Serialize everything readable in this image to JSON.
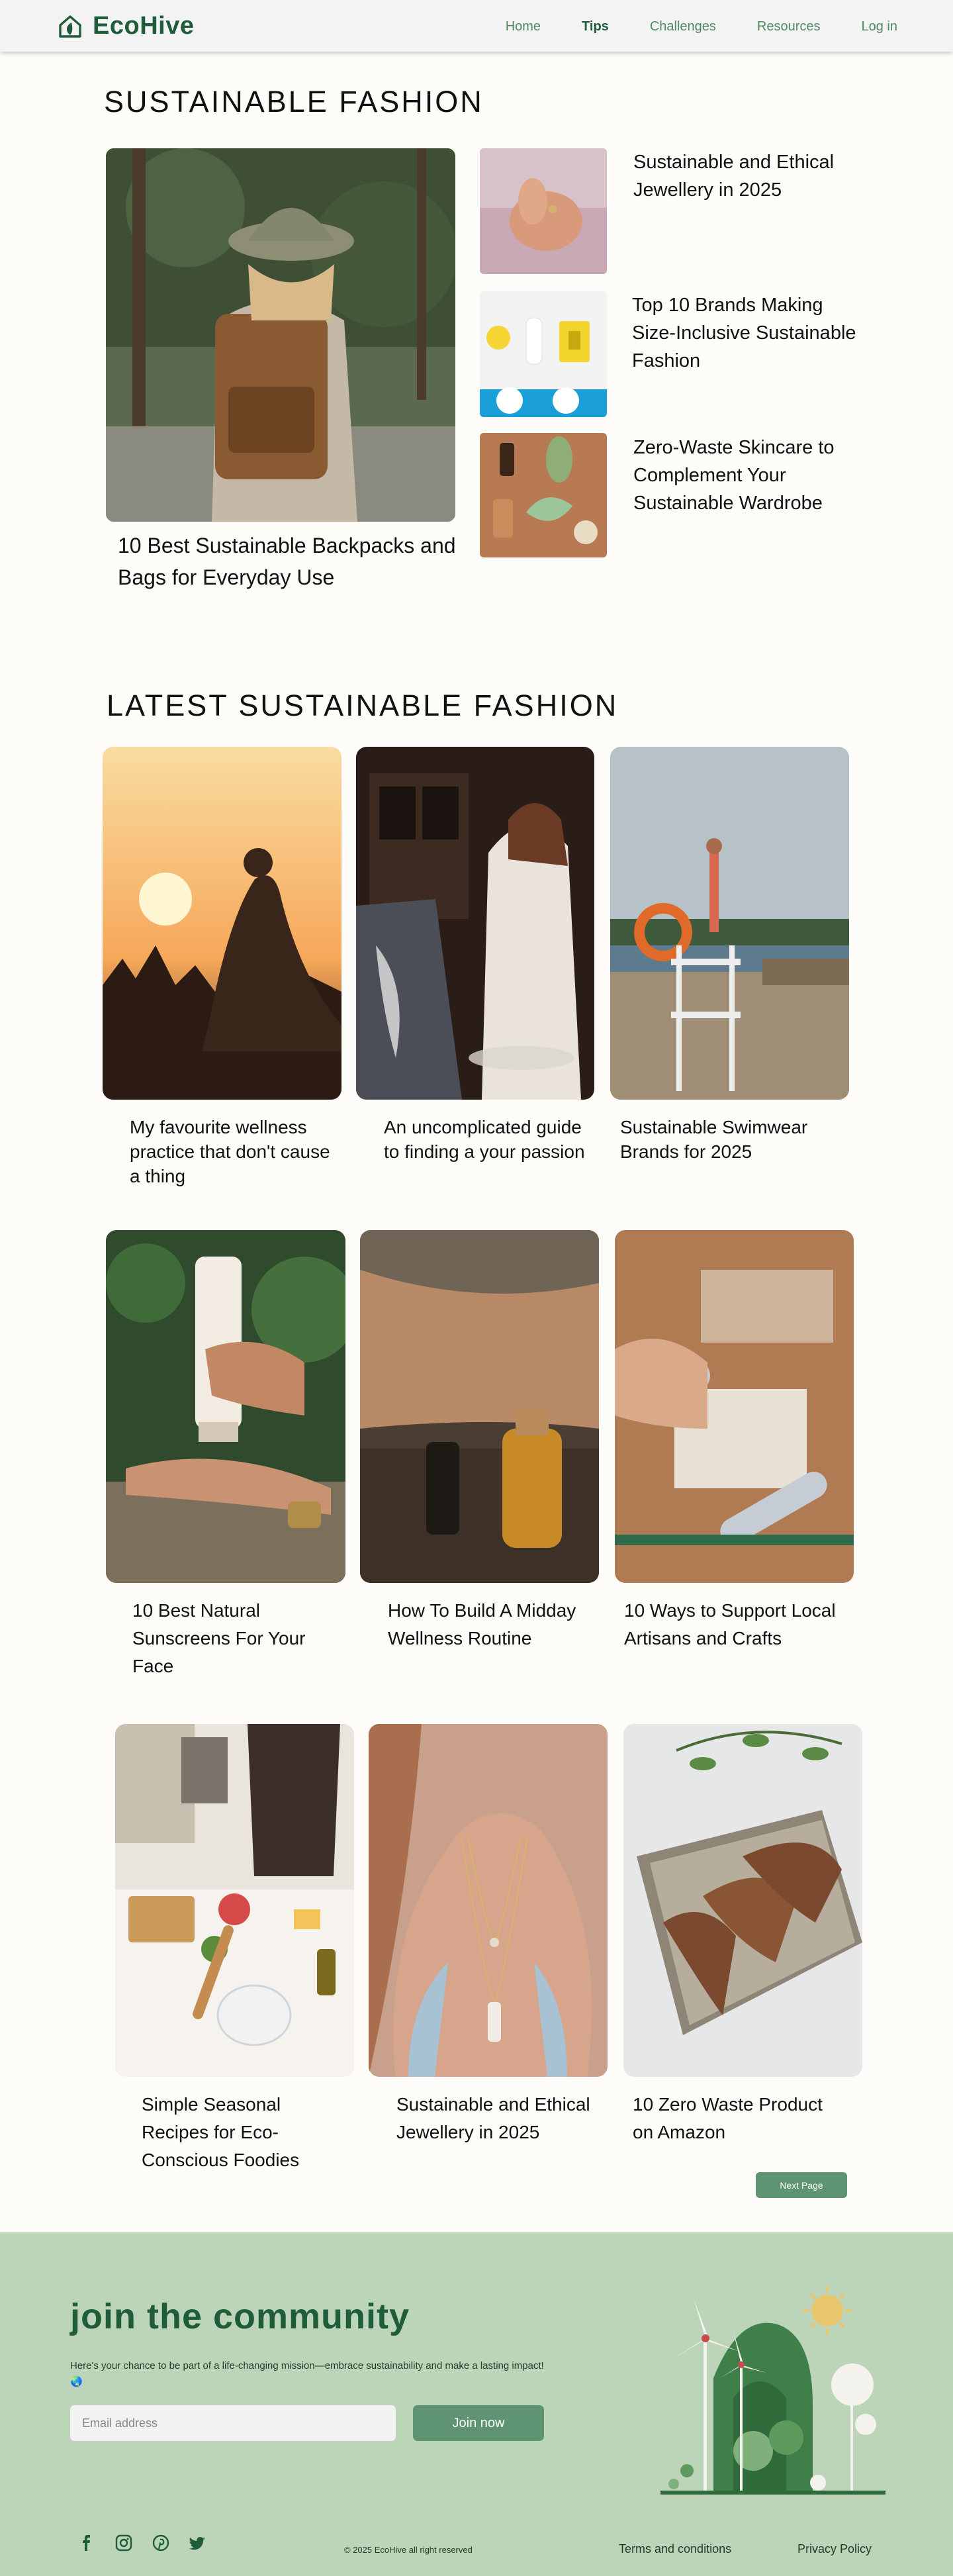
{
  "nav": {
    "brand": "EcoHive",
    "links": [
      "Home",
      "Tips",
      "Challenges",
      "Resources",
      "Log in"
    ],
    "active": "Tips"
  },
  "featured": {
    "title": "SUSTAINABLE FASHION",
    "main_caption": "10 Best Sustainable Backpacks and Bags for Everyday Use",
    "side_items": [
      "Sustainable and Ethical Jewellery in 2025",
      " Top 10 Brands Making Size-Inclusive Sustainable Fashion",
      "Zero-Waste Skincare to Complement Your Sustainable Wardrobe"
    ]
  },
  "latest": {
    "title": "LATEST SUSTAINABLE FASHION",
    "cards": [
      "My favourite wellness practice that don't cause a thing",
      "An uncomplicated guide to finding a your passion",
      "Sustainable Swimwear Brands for 2025",
      "10 Best Natural Sunscreens For Your Face",
      "How To Build A Midday  Wellness Routine",
      "10 Ways to Support Local Artisans and Crafts",
      "Simple Seasonal Recipes for Eco-Conscious  Foodies",
      "Sustainable and Ethical Jewellery in 2025",
      "10 Zero Waste Product on Amazon"
    ],
    "next_label": "Next Page"
  },
  "footer": {
    "join_title": "join the community",
    "join_sub": "Here's your chance to be part of a life-changing mission—embrace sustainability and make a lasting impact! 🌏",
    "email_placeholder": "Email address",
    "join_button": "Join now",
    "copyright": "© 2025 EcoHive all right reserved",
    "links": [
      "Terms and conditions",
      "Privacy Policy"
    ],
    "social_icons": [
      "facebook-icon",
      "instagram-icon",
      "pinterest-icon",
      "twitter-icon"
    ]
  },
  "colors": {
    "brand_green": "#1f5d3a",
    "accent_green": "#5e9471",
    "footer_bg": "#bcd5b9",
    "page_bg": "#fdfcf8"
  }
}
